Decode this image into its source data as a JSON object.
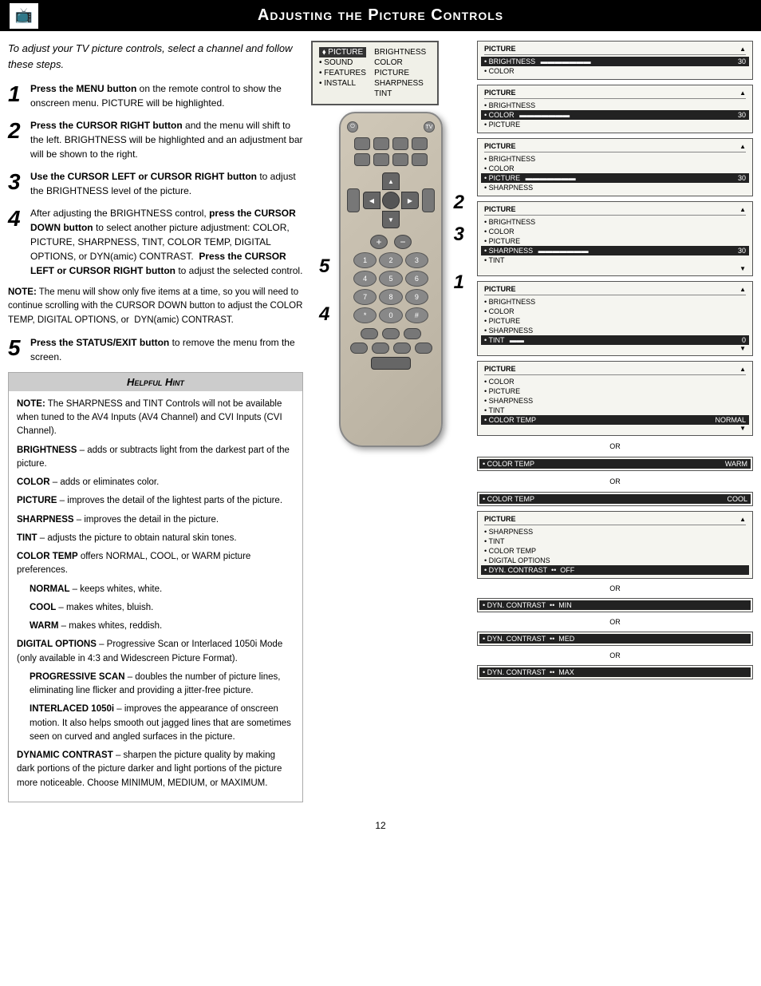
{
  "header": {
    "title": "Adjusting the Picture Controls",
    "logo": "📺"
  },
  "intro": {
    "text": "To adjust your TV picture controls, select a channel and follow these steps."
  },
  "steps": [
    {
      "number": "1",
      "text_parts": [
        {
          "bold": "Press the MENU button",
          "normal": " on the remote control to show the onscreen menu. PICTURE will be highlighted."
        }
      ]
    },
    {
      "number": "2",
      "text_parts": [
        {
          "bold": "Press the CURSOR RIGHT button",
          "normal": " and the menu will shift to the left. BRIGHTNESS will be highlighted and an adjustment bar will be shown to the right."
        }
      ]
    },
    {
      "number": "3",
      "text_parts": [
        {
          "bold": "Use the CURSOR LEFT or CURSOR RIGHT button",
          "normal": " to adjust the BRIGHTNESS level of the picture."
        }
      ]
    },
    {
      "number": "4",
      "text_parts": [
        {
          "bold": "",
          "normal": "After adjusting the BRIGHTNESS control, "
        },
        {
          "bold": "press the CURSOR DOWN button",
          "normal": " to select another picture adjustment: COLOR, PICTURE, SHARPNESS, TINT, COLOR TEMP, DIGITAL OPTIONS, or DYN(amic) CONTRAST.  "
        },
        {
          "bold": "Press the CURSOR LEFT or CURSOR RIGHT button",
          "normal": " to adjust the selected control."
        }
      ]
    },
    {
      "number": "5",
      "text_parts": [
        {
          "bold": "Press the STATUS/EXIT button",
          "normal": " to remove the menu from the screen."
        }
      ]
    }
  ],
  "note": "NOTE:  The menu will show only five items at a time, so you will need to continue scrolling with the CURSOR DOWN button to adjust the COLOR TEMP, DIGITAL OPTIONS, or  DYN(amic) CONTRAST.",
  "helpful_hint": {
    "title": "Helpful Hint",
    "items": [
      {
        "bold": "NOTE:",
        "normal": " The SHARPNESS and TINT Controls will not be available when tuned to the AV4  Inputs (AV4 Channel) and CVI Inputs (CVI Channel)."
      },
      {
        "bold": "BRIGHTNESS",
        "normal": " – adds or subtracts light from the darkest part of the picture."
      },
      {
        "bold": "COLOR",
        "normal": " – adds or eliminates color."
      },
      {
        "bold": "PICTURE",
        "normal": " – improves the detail of the lightest parts of the picture."
      },
      {
        "bold": "SHARPNESS",
        "normal": " – improves the detail in the picture."
      },
      {
        "bold": "TINT",
        "normal": " – adjusts the picture to obtain natural skin tones."
      },
      {
        "bold": "COLOR TEMP",
        "normal": " offers NORMAL, COOL, or WARM picture preferences."
      },
      {
        "indent_bold": "NORMAL",
        "normal": " – keeps whites, white."
      },
      {
        "indent_bold": "COOL",
        "normal": " – makes whites, bluish."
      },
      {
        "indent_bold": "WARM",
        "normal": " – makes whites, reddish."
      },
      {
        "bold": "DIGITAL OPTIONS",
        "normal": " – Progressive Scan or Interlaced 1050i Mode (only available in 4:3 and Widescreen Picture Format)."
      },
      {
        "indent_bold": "PROGRESSIVE SCAN",
        "normal": " – doubles the number of picture lines, eliminating line flicker and providing a jitter-free picture."
      },
      {
        "indent_bold": "INTERLACED 1050i",
        "normal": " – improves the appearance of onscreen motion. It also helps smooth out jagged lines that are sometimes seen on curved and angled surfaces in the picture."
      },
      {
        "bold": "DYNAMIC CONTRAST",
        "normal": " – sharpen the picture quality by making dark portions of the picture darker and light portions of the picture more noticeable. Choose MINIMUM, MEDIUM, or MAXIMUM."
      }
    ]
  },
  "menu_display": {
    "left_items": [
      {
        "text": "• PICTURE",
        "active": true
      },
      {
        "text": "• SOUND",
        "active": false
      },
      {
        "text": "• FEATURES",
        "active": false
      },
      {
        "text": "• INSTALL",
        "active": false
      }
    ],
    "right_items": [
      {
        "text": "BRIGHTNESS",
        "active": false
      },
      {
        "text": "COLOR",
        "active": false
      },
      {
        "text": "PICTURE",
        "active": false
      },
      {
        "text": "SHARPNESS",
        "active": false
      },
      {
        "text": "TINT",
        "active": false
      }
    ]
  },
  "osd_panels": [
    {
      "id": "panel1",
      "title": "PICTURE",
      "arrow_up": true,
      "items": [
        {
          "text": "• BRIGHTNESS",
          "active": true,
          "bar": 70,
          "value": "30"
        },
        {
          "text": "• COLOR",
          "active": false
        }
      ]
    },
    {
      "id": "panel2",
      "title": "PICTURE",
      "arrow_up": true,
      "items": [
        {
          "text": "• BRIGHTNESS",
          "active": false
        },
        {
          "text": "• COLOR",
          "active": true,
          "bar": 70,
          "value": "30"
        },
        {
          "text": "• PICTURE",
          "active": false
        }
      ]
    },
    {
      "id": "panel3",
      "title": "PICTURE",
      "arrow_up": true,
      "items": [
        {
          "text": "• BRIGHTNESS",
          "active": false
        },
        {
          "text": "• COLOR",
          "active": false
        },
        {
          "text": "• PICTURE",
          "active": true,
          "bar": 70,
          "value": "30"
        },
        {
          "text": "• SHARPNESS",
          "active": false
        }
      ]
    },
    {
      "id": "panel4",
      "title": "PICTURE",
      "arrow_up": true,
      "items": [
        {
          "text": "• BRIGHTNESS",
          "active": false
        },
        {
          "text": "• COLOR",
          "active": false
        },
        {
          "text": "• PICTURE",
          "active": false
        },
        {
          "text": "• SHARPNESS",
          "active": true,
          "bar": 70,
          "value": "30"
        },
        {
          "text": "• TINT",
          "active": false
        }
      ],
      "arrow_down": true
    },
    {
      "id": "panel5",
      "title": "PICTURE",
      "arrow_up": true,
      "items": [
        {
          "text": "• BRIGHTNESS",
          "active": false
        },
        {
          "text": "• COLOR",
          "active": false
        },
        {
          "text": "• PICTURE",
          "active": false
        },
        {
          "text": "• SHARPNESS",
          "active": false
        },
        {
          "text": "• TINT",
          "active": true,
          "bar": 20,
          "value": "0"
        }
      ],
      "arrow_down": true
    },
    {
      "id": "panel6",
      "title": "PICTURE",
      "arrow_up": true,
      "items": [
        {
          "text": "• COLOR",
          "active": false
        },
        {
          "text": "• PICTURE",
          "active": false
        },
        {
          "text": "• SHARPNESS",
          "active": false
        },
        {
          "text": "• TINT",
          "active": false
        },
        {
          "text": "• COLOR TEMP",
          "active": true,
          "value_text": "NORMAL"
        }
      ],
      "arrow_down": true
    }
  ],
  "color_temp_labels": [
    {
      "label": "OR"
    },
    {
      "label": "• COLOR TEMP",
      "value": "WARM"
    },
    {
      "label": "OR"
    },
    {
      "label": "• COLOR TEMP",
      "value": "COOL"
    }
  ],
  "dyn_contrast_panels": {
    "title": "PICTURE",
    "items": [
      {
        "text": "• SHARPNESS"
      },
      {
        "text": "• TINT"
      },
      {
        "text": "• COLOR TEMP"
      },
      {
        "text": "• DIGITAL OPTIONS"
      },
      {
        "text": "• DYN. CONTRAST",
        "active": true,
        "value": "OFF"
      }
    ],
    "alternates": [
      {
        "label": "OR"
      },
      {
        "label": "• DYN. CONTRAST",
        "value": "MIN"
      },
      {
        "label": "OR"
      },
      {
        "label": "• DYN. CONTRAST",
        "value": "MED"
      },
      {
        "label": "OR"
      },
      {
        "label": "• DYN. CONTRAST",
        "value": "MAX"
      }
    ]
  },
  "page_number": "12",
  "step_labels": [
    "1",
    "2",
    "3",
    "4",
    "5"
  ]
}
